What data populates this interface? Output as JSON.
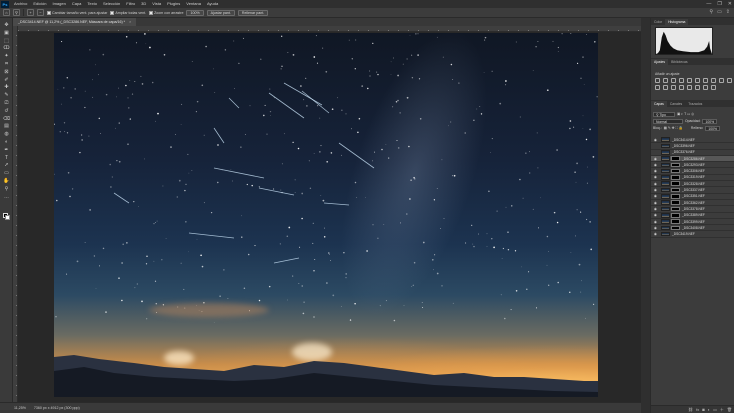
{
  "menu": {
    "logo": "Ps",
    "items": [
      "Archivo",
      "Edición",
      "Imagen",
      "Capa",
      "Texto",
      "Selección",
      "Filtro",
      "3D",
      "Vista",
      "Plugins",
      "Ventana",
      "Ayuda"
    ],
    "window_controls": [
      "—",
      "❐",
      "✕"
    ]
  },
  "options": {
    "checks": [
      {
        "label": "Cambiar tamaño vent. para ajustar"
      },
      {
        "label": "Ampliar todas vent."
      },
      {
        "label": "Zoom con arrastre"
      }
    ],
    "zoom_value": "100%",
    "fit_screen": "Ajustar pant.",
    "fill_screen": "Rellenar pant."
  },
  "document": {
    "tab_title": "_DSC3414.NEF @ 11,2% (_DSC3286.NEF, Máscara de capa/16) *",
    "close": "×"
  },
  "status": {
    "zoom": "11,25%",
    "doc_size": "7360 px x 4912 px (300 ppp)"
  },
  "panels": {
    "top_tabs": [
      "Color",
      "Histograma"
    ],
    "adj_tabs": [
      "Ajustes",
      "Bibliotecas"
    ],
    "adj_label": "Añadir un ajuste",
    "layer_tabs": [
      "Capas",
      "Canales",
      "Trazados"
    ],
    "kind_filter": "Tipo",
    "blend_mode": "Normal",
    "opacity_label": "Opacidad:",
    "opacity_value": "100%",
    "lock_label": "Bloq.:",
    "fill_label": "Relleno:",
    "fill_value": "100%",
    "layers": [
      {
        "name": "_DSC3414.NEF",
        "mask": false,
        "selected": false,
        "visible": true
      },
      {
        "name": "_DSC3396.NEF",
        "mask": false,
        "selected": false,
        "visible": false
      },
      {
        "name": "_DSC3376.NEF",
        "mask": false,
        "selected": false,
        "visible": false
      },
      {
        "name": "_DSC3286.NEF",
        "mask": true,
        "selected": true,
        "visible": true
      },
      {
        "name": "_DSC3293.NEF",
        "mask": true,
        "selected": false,
        "visible": true
      },
      {
        "name": "_DSC3306.NEF",
        "mask": true,
        "selected": false,
        "visible": true
      },
      {
        "name": "_DSC3319.NEF",
        "mask": true,
        "selected": false,
        "visible": true
      },
      {
        "name": "_DSC3328.NEF",
        "mask": true,
        "selected": false,
        "visible": true
      },
      {
        "name": "_DSC3337.NEF",
        "mask": true,
        "selected": false,
        "visible": true
      },
      {
        "name": "_DSC3351.NEF",
        "mask": true,
        "selected": false,
        "visible": true
      },
      {
        "name": "_DSC3362.NEF",
        "mask": true,
        "selected": false,
        "visible": true
      },
      {
        "name": "_DSC3378.NEF",
        "mask": true,
        "selected": false,
        "visible": true
      },
      {
        "name": "_DSC3389.NEF",
        "mask": true,
        "selected": false,
        "visible": true
      },
      {
        "name": "_DSC3399.NEF",
        "mask": true,
        "selected": false,
        "visible": true
      },
      {
        "name": "_DSC3408.NEF",
        "mask": true,
        "selected": false,
        "visible": true
      },
      {
        "name": "_DSC3419.NEF",
        "mask": false,
        "selected": false,
        "visible": true
      }
    ]
  },
  "tools": [
    "move-tool",
    "artboard-tool",
    "marquee-tool",
    "lasso-tool",
    "quick-select-tool",
    "crop-tool",
    "frame-tool",
    "eyedropper-tool",
    "spot-heal-tool",
    "brush-tool",
    "clone-stamp-tool",
    "history-brush-tool",
    "eraser-tool",
    "gradient-tool",
    "blur-tool",
    "dodge-tool",
    "pen-tool",
    "type-tool",
    "path-select-tool",
    "rectangle-tool",
    "hand-tool",
    "zoom-tool",
    "edit-toolbar-tool"
  ],
  "colors": {
    "accent": "#31a8ff",
    "ui_dark": "#2f2f2f",
    "panel": "#3c3c3c"
  }
}
